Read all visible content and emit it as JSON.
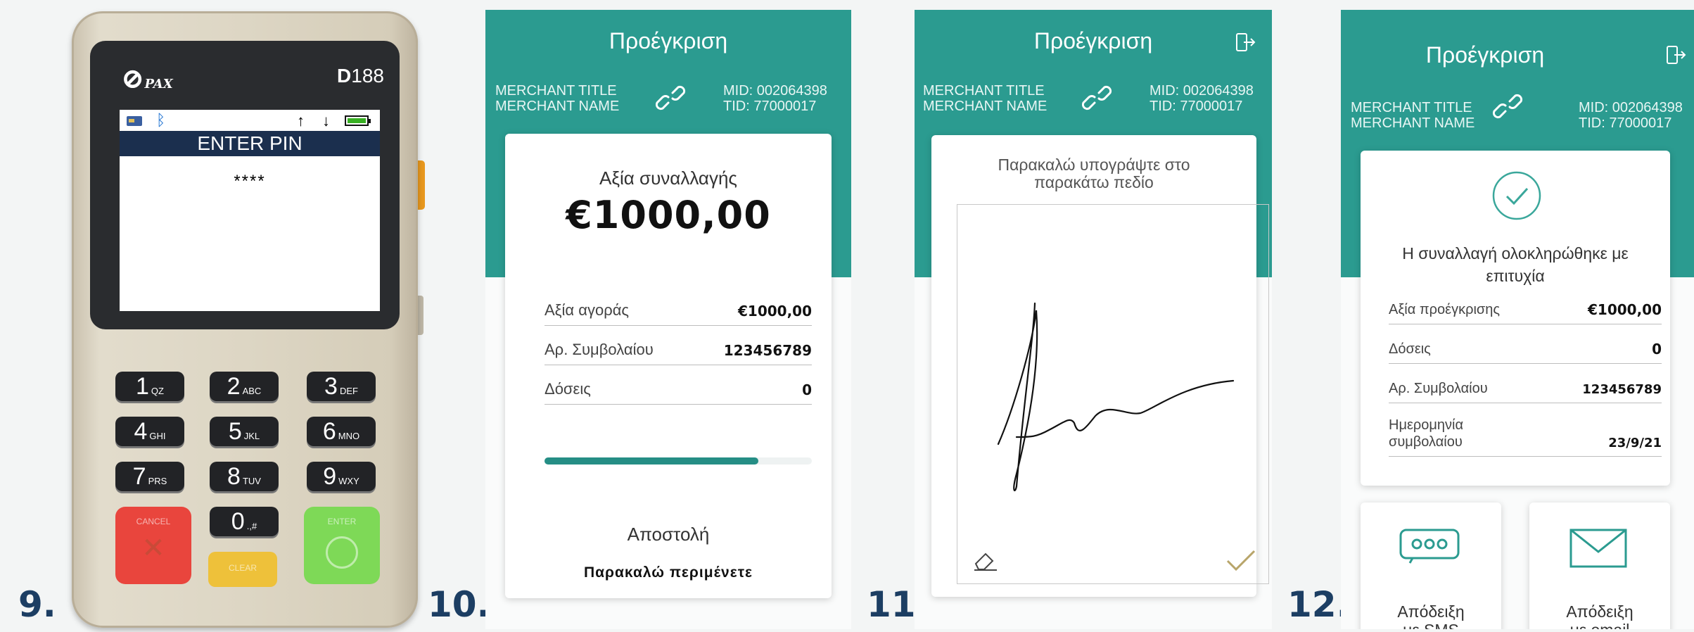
{
  "step_numbers": [
    "9.",
    "10.",
    "11.",
    "12."
  ],
  "terminal": {
    "brand": "PAX",
    "model_prefix": "D",
    "model_number": "188",
    "screen_title": "ENTER PIN",
    "pin_mask": "****",
    "keys": [
      {
        "digit": "1",
        "letters": "QZ"
      },
      {
        "digit": "2",
        "letters": "ABC"
      },
      {
        "digit": "3",
        "letters": "DEF"
      },
      {
        "digit": "4",
        "letters": "GHI"
      },
      {
        "digit": "5",
        "letters": "JKL"
      },
      {
        "digit": "6",
        "letters": "MNO"
      },
      {
        "digit": "7",
        "letters": "PRS"
      },
      {
        "digit": "8",
        "letters": "TUV"
      },
      {
        "digit": "9",
        "letters": "WXY"
      },
      {
        "digit": "0",
        "letters": ".,#"
      }
    ],
    "cancel_label": "CANCEL",
    "clear_label": "CLEAR",
    "enter_label": "ENTER",
    "colors": {
      "cancel": "#e9453d",
      "clear": "#eec13a",
      "enter": "#7ed957",
      "lcd_title_bg": "#1b2f4e"
    }
  },
  "common": {
    "header_title": "Προέγκριση",
    "merchant_title": "MERCHANT TITLE",
    "merchant_name": "MERCHANT NAME",
    "mid": "MID: 002064398",
    "tid": "TID: 77000017",
    "accent": "#2b9b90"
  },
  "screen10": {
    "amount_label": "Αξία συναλλαγής",
    "amount": "€1000,00",
    "rows": [
      {
        "label": "Αξία αγοράς",
        "value": "€1000,00"
      },
      {
        "label": "Αρ. Συμβολαίου",
        "value": "123456789"
      },
      {
        "label": "Δόσεις",
        "value": "0"
      }
    ],
    "progress": 0.8,
    "status": "Αποστολή",
    "wait": "Παρακαλώ περιμένετε"
  },
  "screen11": {
    "prompt": "Παρακαλώ υπογράψτε στο παρακάτω πεδίο"
  },
  "screen12": {
    "success": "Η συναλλαγή ολοκληρώθηκε με επιτυχία",
    "rows": [
      {
        "label": "Αξία προέγκρισης",
        "value": "€1000,00"
      },
      {
        "label": "Δόσεις",
        "value": "0"
      },
      {
        "label": "Αρ. Συμβολαίου",
        "value": "123456789"
      }
    ],
    "date_label_1": "Ημερομηνία",
    "date_label_2": "συμβολαίου",
    "date_value": "23/9/21",
    "sms_line1": "Απόδειξη",
    "sms_line2": "με SMS",
    "email_line1": "Απόδειξη",
    "email_line2": "με email"
  }
}
